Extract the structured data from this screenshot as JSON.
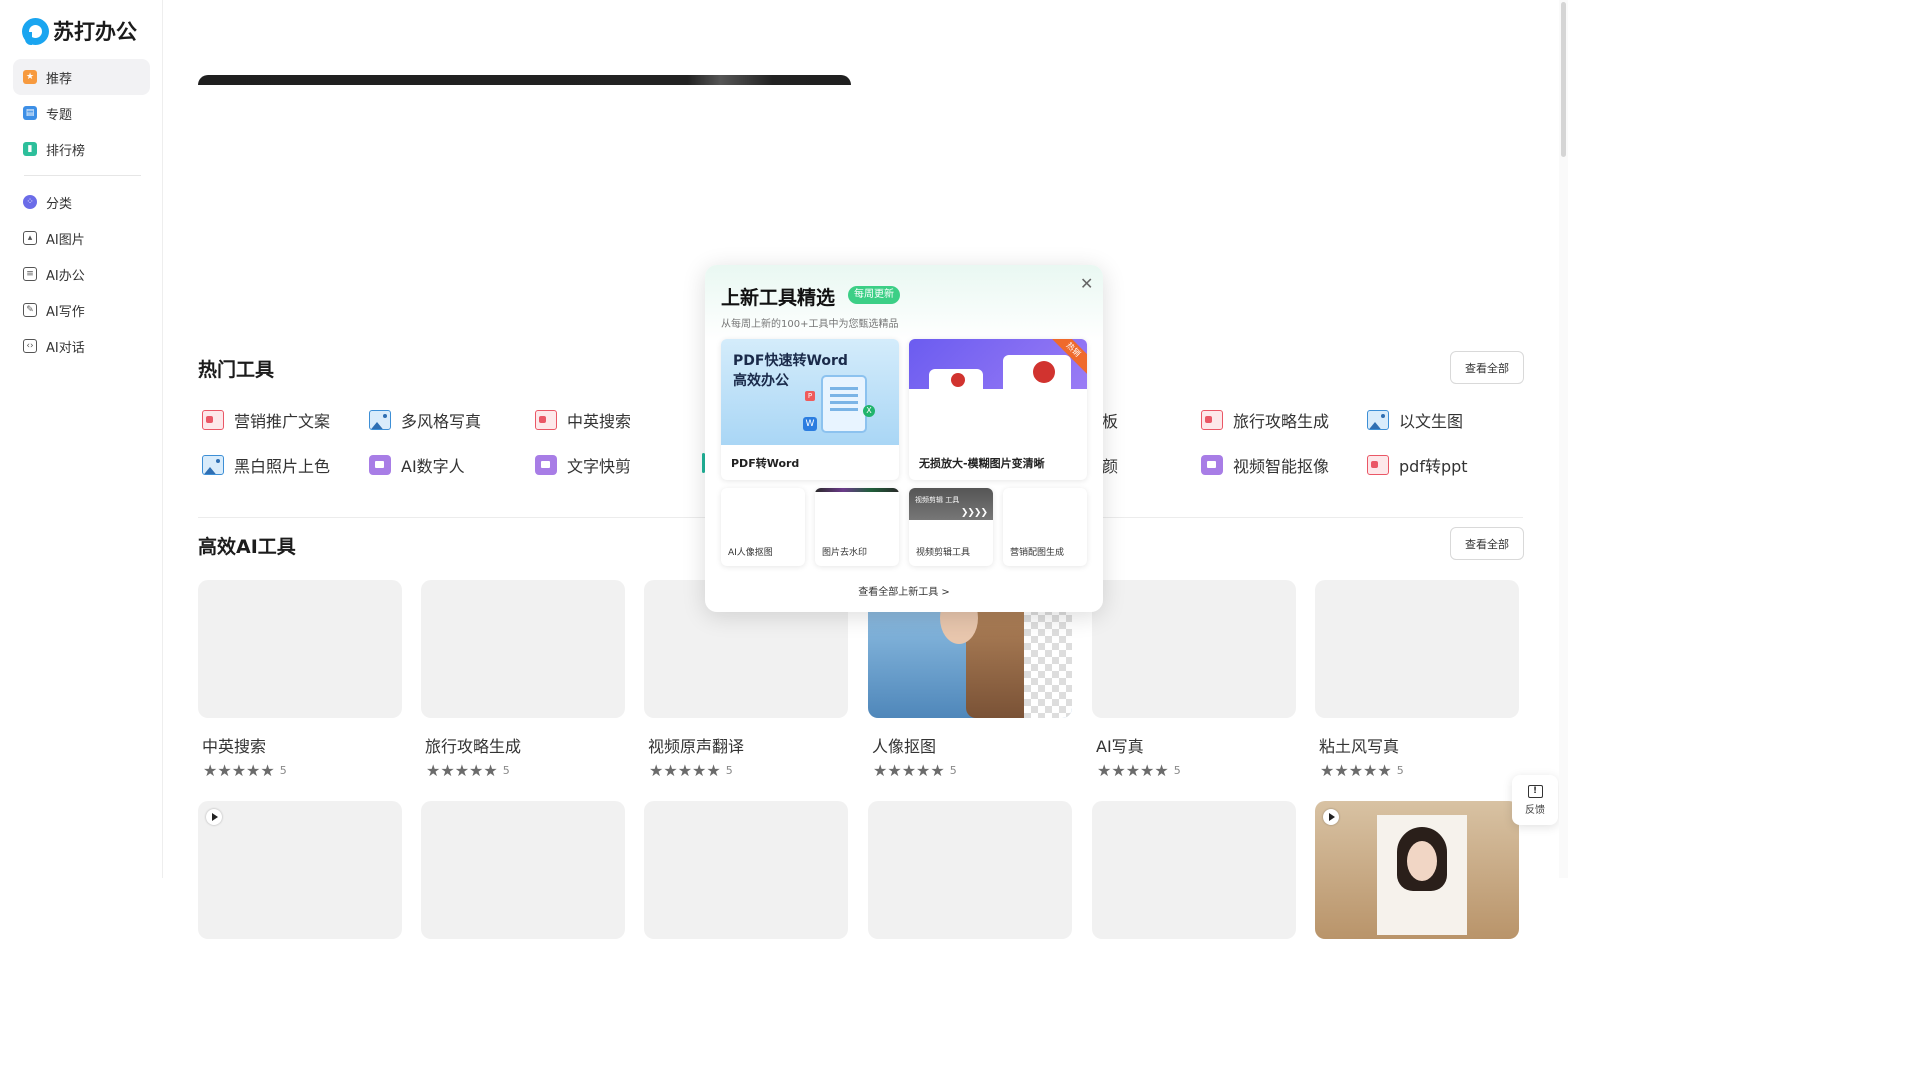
{
  "brand": {
    "name": "苏打办公",
    "color": "#1aa5f0"
  },
  "nav": {
    "top": [
      {
        "label": "推荐",
        "icon": "star-icon",
        "color": "#f79a3e",
        "active": true
      },
      {
        "label": "专题",
        "icon": "bookmark-icon",
        "color": "#3d8fe6"
      },
      {
        "label": "排行榜",
        "icon": "ranking-icon",
        "color": "#2dbf9b"
      }
    ],
    "bottom": [
      {
        "label": "分类",
        "icon": "category-icon",
        "color": "#6b6ce8"
      },
      {
        "label": "AI图片",
        "icon": "ai-image-icon"
      },
      {
        "label": "AI办公",
        "icon": "ai-office-icon"
      },
      {
        "label": "AI写作",
        "icon": "ai-writing-icon"
      },
      {
        "label": "AI对话",
        "icon": "ai-chat-icon"
      }
    ]
  },
  "hot_tools": {
    "title": "热门工具",
    "view_all": "查看全部",
    "row1": [
      {
        "label": "营销推广文案",
        "icon": "pdf-icon"
      },
      {
        "label": "多风格写真",
        "icon": "image-icon"
      },
      {
        "label": "中英搜索",
        "icon": "pdf-icon"
      },
      {
        "label": "模板",
        "icon": "none"
      },
      {
        "label": "旅行攻略生成",
        "icon": "pdf-icon"
      },
      {
        "label": "以文生图",
        "icon": "image-icon"
      }
    ],
    "row2": [
      {
        "label": "黑白照片上色",
        "icon": "image-icon"
      },
      {
        "label": "AI数字人",
        "icon": "video-icon"
      },
      {
        "label": "文字快剪",
        "icon": "video-icon"
      },
      {
        "label": "美颜",
        "icon": "none"
      },
      {
        "label": "视频智能抠像",
        "icon": "video-icon"
      },
      {
        "label": "pdf转ppt",
        "icon": "pdf-icon"
      }
    ]
  },
  "ai_tools": {
    "title": "高效AI工具",
    "view_all": "查看全部",
    "cards": [
      {
        "title": "中英搜索",
        "rating": "5"
      },
      {
        "title": "旅行攻略生成",
        "rating": "5"
      },
      {
        "title": "视频原声翻译",
        "rating": "5"
      },
      {
        "title": "人像抠图",
        "rating": "5"
      },
      {
        "title": "AI写真",
        "rating": "5"
      },
      {
        "title": "粘土风写真",
        "rating": "5"
      }
    ]
  },
  "feedback": {
    "label": "反馈"
  },
  "popup": {
    "title": "上新工具精选",
    "badge": "每周更新",
    "subtitle": "从每周上新的100+工具中为您甄选精品",
    "big": [
      {
        "label": "PDF转Word",
        "image_text_1": "PDF快速转Word",
        "image_text_2": "高效办公"
      },
      {
        "label": "无损放大-模糊图片变清晰",
        "corner": "热销"
      }
    ],
    "small": [
      {
        "label": "AI人像抠图"
      },
      {
        "label": "图片去水印"
      },
      {
        "label": "视频剪辑工具",
        "image_text": "视频剪辑 工具"
      },
      {
        "label": "营销配图生成"
      }
    ],
    "more": "查看全部上新工具 >"
  }
}
